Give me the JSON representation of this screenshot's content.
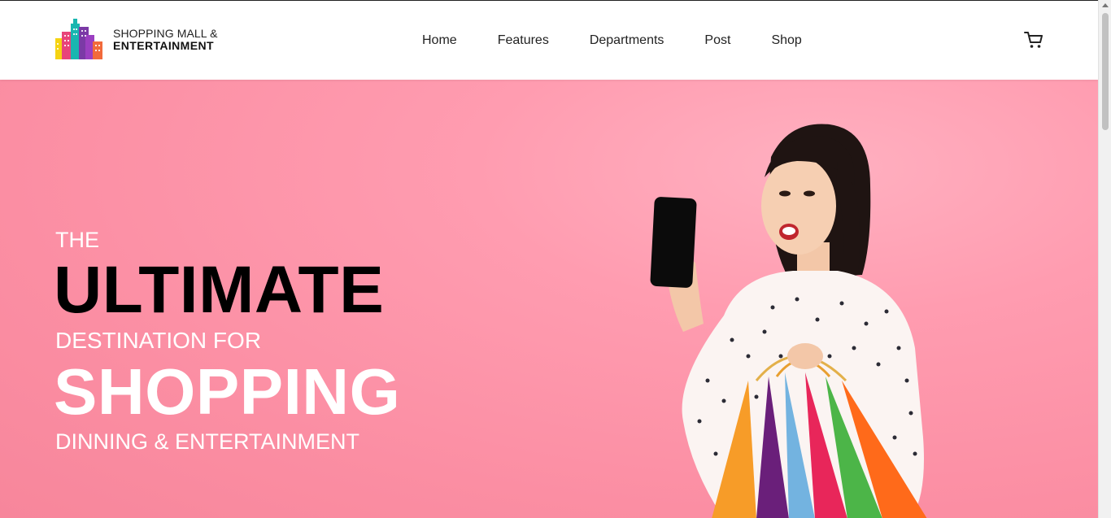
{
  "logo": {
    "line1": "SHOPPING MALL &",
    "line2": "ENTERTAINMENT",
    "icon": "buildings-logo-icon"
  },
  "nav": {
    "items": [
      {
        "label": "Home"
      },
      {
        "label": "Features"
      },
      {
        "label": "Departments"
      },
      {
        "label": "Post"
      },
      {
        "label": "Shop"
      }
    ],
    "cart_icon": "shopping-cart-icon"
  },
  "hero": {
    "line_the": "THE",
    "line_ultimate": "ULTIMATE",
    "line_destination": "DESTINATION FOR",
    "line_shopping": "SHOPPING",
    "line_dinning": "DINNING & ENTERTAINMENT",
    "background_color": "#fb8ea3",
    "image": "woman-holding-phone-and-shopping-bags"
  },
  "colors": {
    "accent_pink": "#fb8ea3",
    "text_dark": "#000000",
    "text_light": "#ffffff"
  }
}
